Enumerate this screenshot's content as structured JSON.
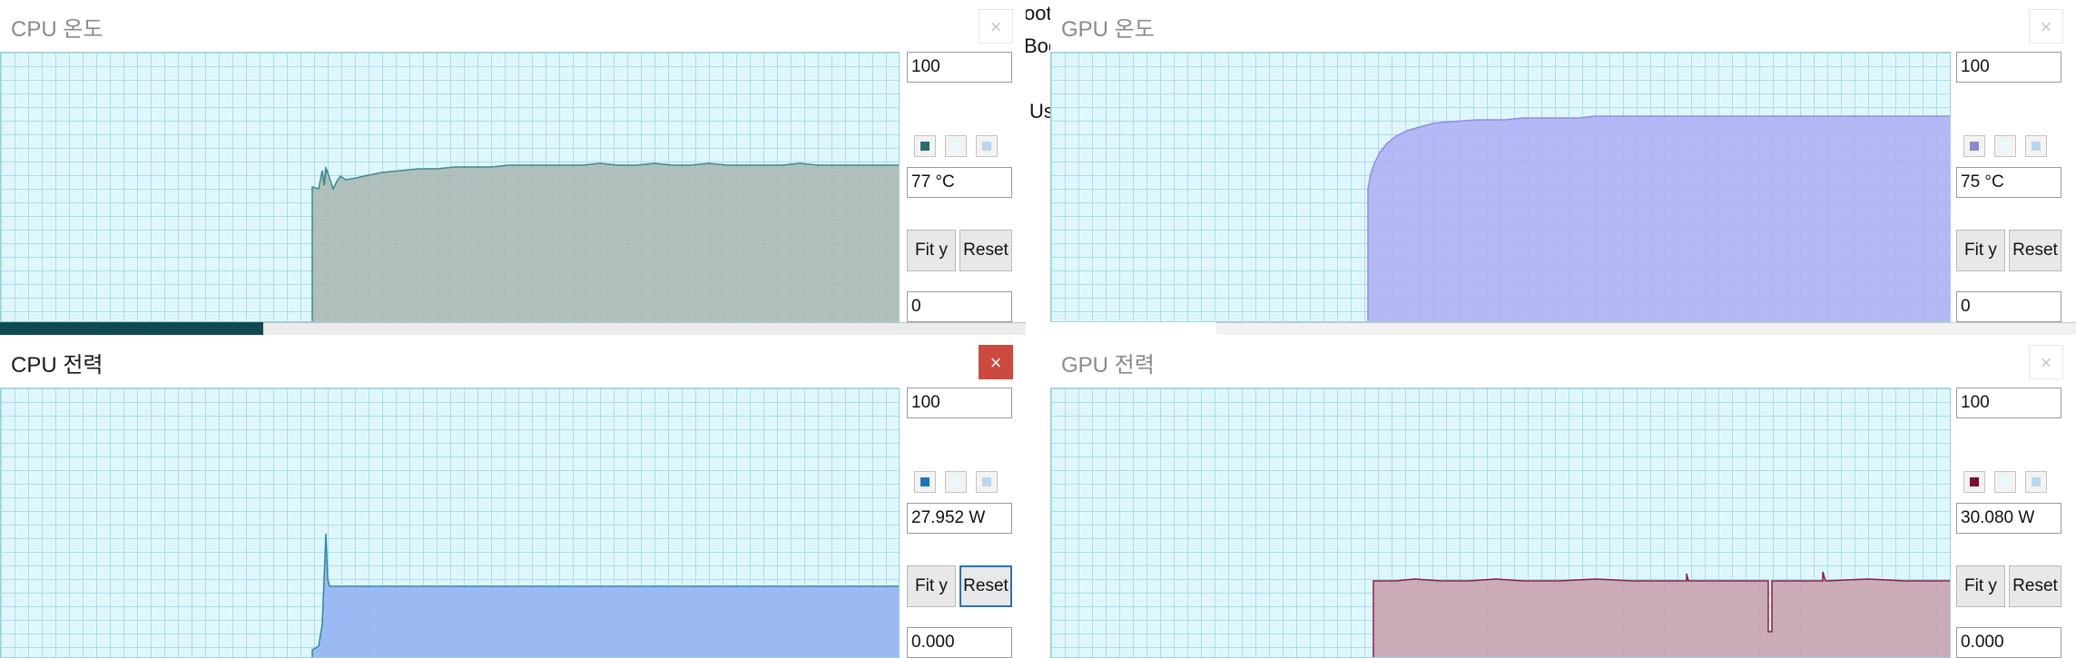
{
  "background": {
    "fragments": [
      "oot",
      "Boo",
      "Us"
    ]
  },
  "windows": [
    {
      "id": "cpu_temp",
      "title": "CPU 온도",
      "active": false,
      "close_label": "×",
      "fill_color": "#a9b6b0",
      "stroke_color": "#3d8a8e",
      "swatch_color": "#2d6c6e",
      "ymax_value": "100",
      "current_value": "77 °C",
      "ymin_value": "0",
      "fit_label": "Fit y",
      "reset_label": "Reset"
    },
    {
      "id": "gpu_temp",
      "title": "GPU 온도",
      "active": false,
      "close_label": "×",
      "fill_color": "#b1b4f4",
      "stroke_color": "#8a8fe8",
      "swatch_color": "#8b8ad0",
      "ymax_value": "100",
      "current_value": "75 °C",
      "ymin_value": "0",
      "fit_label": "Fit y",
      "reset_label": "Reset"
    },
    {
      "id": "cpu_power",
      "title": "CPU 전력",
      "active": true,
      "close_label": "×",
      "fill_color": "#97b6f2",
      "stroke_color": "#2c8aa8",
      "swatch_color": "#1b78b8",
      "ymax_value": "100",
      "current_value": "27.952 W",
      "ymin_value": "0.000",
      "fit_label": "Fit y",
      "reset_label": "Reset"
    },
    {
      "id": "gpu_power",
      "title": "GPU 전력",
      "active": false,
      "close_label": "×",
      "fill_color": "#c9a6b4",
      "stroke_color": "#8a2040",
      "swatch_color": "#7a1032",
      "ymax_value": "100",
      "current_value": "30.080 W",
      "ymin_value": "0.000",
      "fit_label": "Fit y",
      "reset_label": "Reset"
    }
  ]
}
